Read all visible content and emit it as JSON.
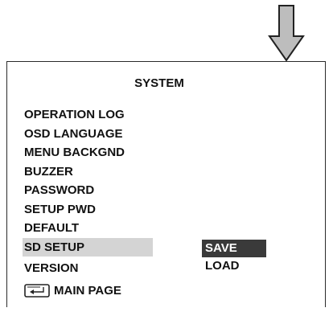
{
  "panel": {
    "title": "SYSTEM"
  },
  "menu": {
    "items": [
      {
        "label": "OPERATION LOG"
      },
      {
        "label": "OSD LANGUAGE"
      },
      {
        "label": "MENU BACKGND"
      },
      {
        "label": "BUZZER"
      },
      {
        "label": "PASSWORD"
      },
      {
        "label": "SETUP PWD"
      },
      {
        "label": "DEFAULT"
      },
      {
        "label": "SD SETUP",
        "selected": true
      },
      {
        "label": "VERSION"
      }
    ],
    "main_page_label": "MAIN PAGE",
    "main_page_icon": "enter-key-icon"
  },
  "submenu": {
    "items": [
      {
        "label": "SAVE",
        "selected": true
      },
      {
        "label": "LOAD"
      }
    ]
  },
  "indicator": {
    "icon": "down-arrow-icon"
  },
  "colors": {
    "highlight": "#d4d4d4",
    "selected_sub": "#3a3a3a"
  }
}
